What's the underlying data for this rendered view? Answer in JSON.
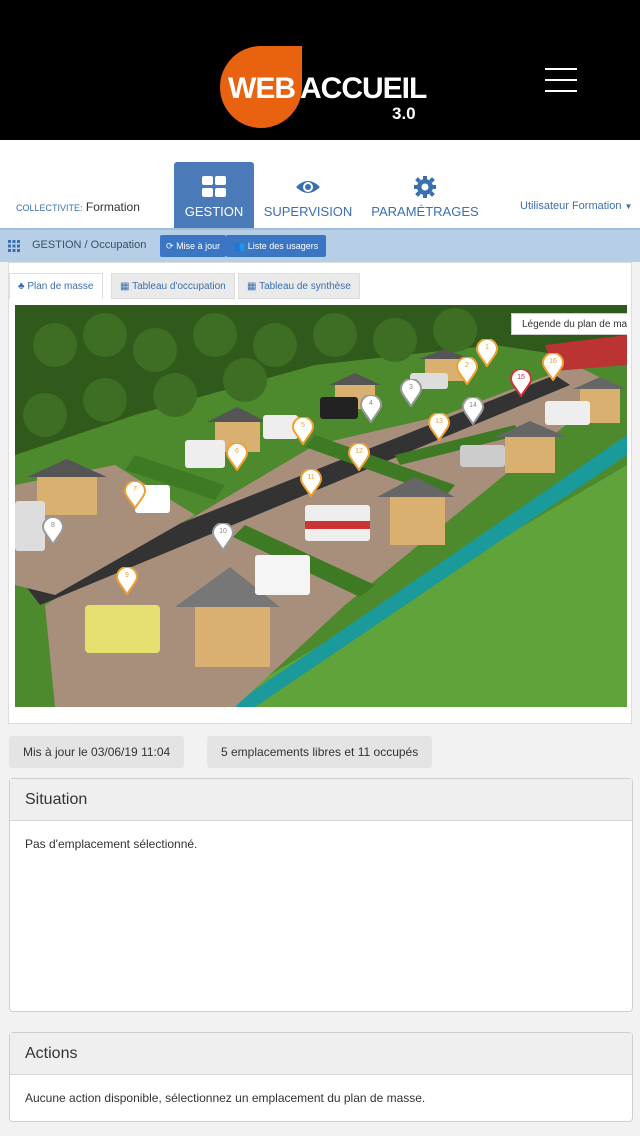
{
  "header": {
    "logo_web": "WEB",
    "logo_accueil": "ACCUEIL",
    "logo_version": "3.0"
  },
  "nav": {
    "collectivite_label": "COLLECTIVITE:",
    "collectivite_value": "Formation",
    "tabs": [
      {
        "label": "GESTION",
        "icon": "grid-icon",
        "active": true
      },
      {
        "label": "SUPERVISION",
        "icon": "eye-icon",
        "active": false
      },
      {
        "label": "PARAMÉTRAGES",
        "icon": "gear-icon",
        "active": false
      }
    ],
    "user": "Utilisateur Formation"
  },
  "breadcrumb": {
    "text": "GESTION / Occupation",
    "refresh_button": "Mise à jour",
    "users_button": "Liste des usagers"
  },
  "content_tabs": [
    {
      "label": "Plan de masse",
      "active": true
    },
    {
      "label": "Tableau d'occupation",
      "active": false
    },
    {
      "label": "Tableau de synthèse",
      "active": false
    }
  ],
  "map": {
    "legend_label": "Légende du plan de masse",
    "markers": [
      {
        "num": "1",
        "status": "orange"
      },
      {
        "num": "2",
        "status": "orange"
      },
      {
        "num": "3",
        "status": "white"
      },
      {
        "num": "4",
        "status": "white"
      },
      {
        "num": "5",
        "status": "orange"
      },
      {
        "num": "6",
        "status": "orange"
      },
      {
        "num": "7",
        "status": "orange"
      },
      {
        "num": "8",
        "status": "white"
      },
      {
        "num": "9",
        "status": "orange"
      },
      {
        "num": "10",
        "status": "white"
      },
      {
        "num": "11",
        "status": "orange"
      },
      {
        "num": "12",
        "status": "orange"
      },
      {
        "num": "13",
        "status": "orange"
      },
      {
        "num": "14",
        "status": "white"
      },
      {
        "num": "15",
        "status": "red"
      },
      {
        "num": "16",
        "status": "orange"
      }
    ]
  },
  "status": {
    "updated": "Mis à jour le 03/06/19 11:04",
    "summary": "5 emplacements libres et 11 occupés"
  },
  "situation": {
    "title": "Situation",
    "body": "Pas d'emplacement sélectionné."
  },
  "actions": {
    "title": "Actions",
    "body": "Aucune action disponible, sélectionnez un emplacement du plan de masse."
  },
  "colors": {
    "brand_orange": "#e8620f",
    "nav_blue": "#4a7ab8",
    "marker_orange": "#f0a030",
    "marker_red": "#d0343a"
  }
}
